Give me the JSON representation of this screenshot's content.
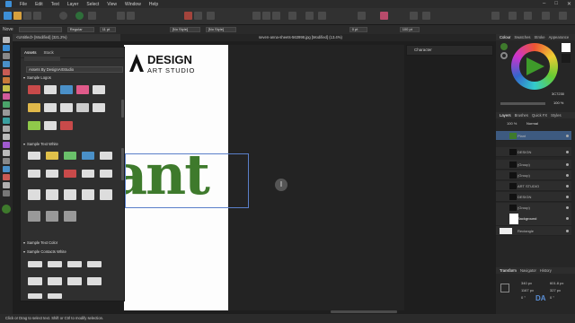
{
  "menu": [
    "File",
    "Edit",
    "Text",
    "Layer",
    "Select",
    "View",
    "Window",
    "Help"
  ],
  "window_controls": [
    "–",
    "□",
    "✕"
  ],
  "context": {
    "font_label": "Nove",
    "font_style": "Regular",
    "font_size": "11 pt",
    "paragraph_style": "[No Style]",
    "text_style": "[No Style]",
    "tracking": "0 pt",
    "leading": "100 pt"
  },
  "tabs": [
    {
      "label": "<Untitled> [Modified] (321.2%)",
      "active": true
    },
    {
      "label": "seven-anna-sheets-563998.jpg [Modified] (13.4%)",
      "active": false
    }
  ],
  "assets": {
    "tab_assets": "Assets",
    "tab_stock": "Stock",
    "category": "Assets By DesignArtStudio",
    "sections": [
      "Sample Logos",
      "Sample Text White",
      "Sample Text Color",
      "Sample Contacts White"
    ]
  },
  "canvas": {
    "brand_line1": "DESIGN",
    "brand_line2": "ART STUDIO",
    "big_word": "ant"
  },
  "character_panel": {
    "title": "Character"
  },
  "right_dock": {
    "color_tabs": [
      "Colour",
      "Swatches",
      "Stroke",
      "Appearance"
    ],
    "opacity": "100 %",
    "hex_value": "3C7230",
    "layers_tabs": [
      "Layers",
      "Brushes",
      "Quick FX",
      "Styles"
    ],
    "blend_opacity": "100 %",
    "blend_mode": "Normal",
    "layers": [
      {
        "name": "Plant",
        "selected": true
      },
      {
        "name": "DESIGN",
        "selected": false
      },
      {
        "name": "(Group)",
        "selected": false
      },
      {
        "name": "(Group)",
        "selected": false
      },
      {
        "name": "ART STUDIO",
        "selected": false
      },
      {
        "name": "DESIGN",
        "selected": false
      },
      {
        "name": "(Group)",
        "selected": false
      },
      {
        "name": "Background",
        "selected": false
      },
      {
        "name": "Rectangle",
        "selected": false
      }
    ],
    "transform_tabs": [
      "Transform",
      "Navigator",
      "History"
    ],
    "transform": {
      "x": "340 px",
      "y": "1167 px",
      "w": "601.8 px",
      "h": "327 px",
      "r": "0 °",
      "s": "0 °"
    },
    "da_logo": "DA"
  },
  "status": "Click or Drag to select text. Shift or Ctrl to modify selection.",
  "colors": {
    "accent": "#3d8fd6",
    "plant_green": "#3e7a2c",
    "selection": "#5a7fc9"
  }
}
